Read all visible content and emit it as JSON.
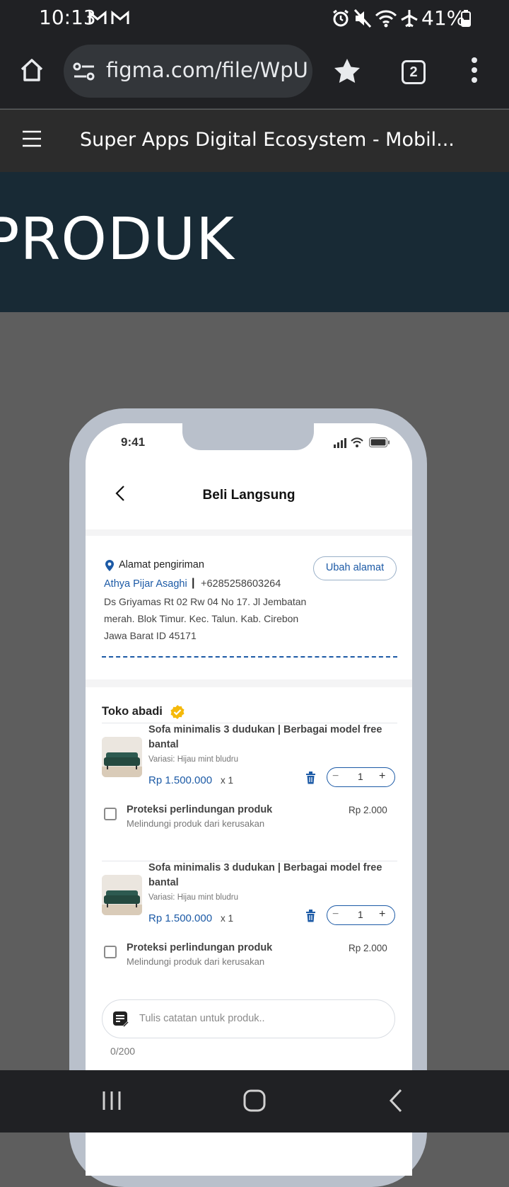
{
  "status_bar": {
    "time": "10:13",
    "battery": "41%"
  },
  "browser": {
    "url": "figma.com/file/WpUi",
    "tab_count": "2"
  },
  "figma": {
    "file_title": "Super Apps Digital Ecosystem - Mobil..."
  },
  "banner": {
    "text": "PRODUK"
  },
  "mockup": {
    "status_time": "9:41",
    "page_title": "Beli Langsung",
    "address": {
      "label": "Alamat pengiriman",
      "change_button": "Ubah alamat",
      "name": "Athya Pijar Asaghi",
      "separator": "|",
      "phone": "+6285258603264",
      "lines": [
        "Ds Griyamas Rt 02 Rw 04 No 17. Jl Jembatan",
        "merah. Blok Timur. Kec. Talun. Kab. Cirebon",
        "Jawa Barat ID 45171"
      ]
    },
    "store": {
      "name": "Toko abadi",
      "items": [
        {
          "title_line1": "Sofa minimalis 3 dudukan | Berbagai model free",
          "title_line2": "bantal",
          "variant": "Variasi: Hijau mint bludru",
          "price": "Rp 1.500.000",
          "qty_label": "x 1",
          "stepper_minus": "−",
          "stepper_value": "1",
          "stepper_plus": "+",
          "protection_title": "Proteksi perlindungan produk",
          "protection_desc": "Melindungi produk dari kerusakan",
          "protection_price": "Rp 2.000"
        },
        {
          "title_line1": "Sofa minimalis 3 dudukan | Berbagai model free",
          "title_line2": "bantal",
          "variant": "Variasi: Hijau mint bludru",
          "price": "Rp 1.500.000",
          "qty_label": "x 1",
          "stepper_minus": "−",
          "stepper_value": "1",
          "stepper_plus": "+",
          "protection_title": "Proteksi perlindungan produk",
          "protection_desc": "Melindungi produk dari kerusakan",
          "protection_price": "Rp 2.000"
        }
      ],
      "note_placeholder": "Tulis catatan untuk produk..",
      "note_counter": "0/200"
    }
  },
  "colors": {
    "accent_blue": "#1c5aa6",
    "verified_yellow": "#f5b90a",
    "trash_blue": "#1c5aa6"
  }
}
